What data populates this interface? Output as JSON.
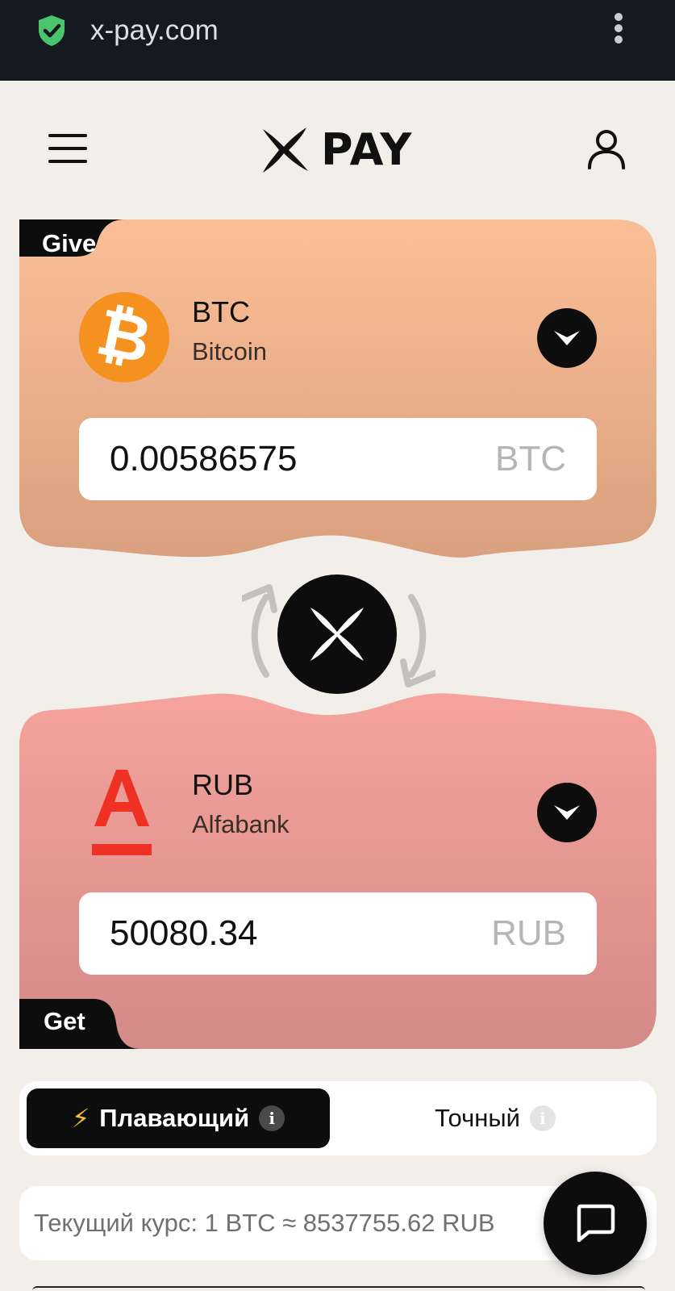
{
  "browser": {
    "url": "x-pay.com"
  },
  "header": {
    "logo_text": "PAY"
  },
  "give": {
    "label": "Give",
    "currency_code": "BTC",
    "currency_name": "Bitcoin",
    "amount": "0.00586575",
    "unit": "BTC",
    "coin_symbol": "₿"
  },
  "get": {
    "label": "Get",
    "currency_code": "RUB",
    "currency_name": "Alfabank",
    "amount": "50080.34",
    "unit": "RUB"
  },
  "rate_mode": {
    "options": [
      {
        "label": "Плавающий",
        "selected": true
      },
      {
        "label": "Точный",
        "selected": false
      }
    ],
    "info_glyph": "i"
  },
  "current_rate": {
    "text": "Текущий курс: 1 BTC ≈ 8537755.62 RUB"
  },
  "colors": {
    "give_top": "#fbbf97",
    "give_bottom": "#d9a07f",
    "get_top": "#f5a39c",
    "get_bottom": "#d48a88",
    "dark": "#0d0d0d",
    "alfa_red": "#ef3124",
    "btc_orange": "#f5911e"
  }
}
